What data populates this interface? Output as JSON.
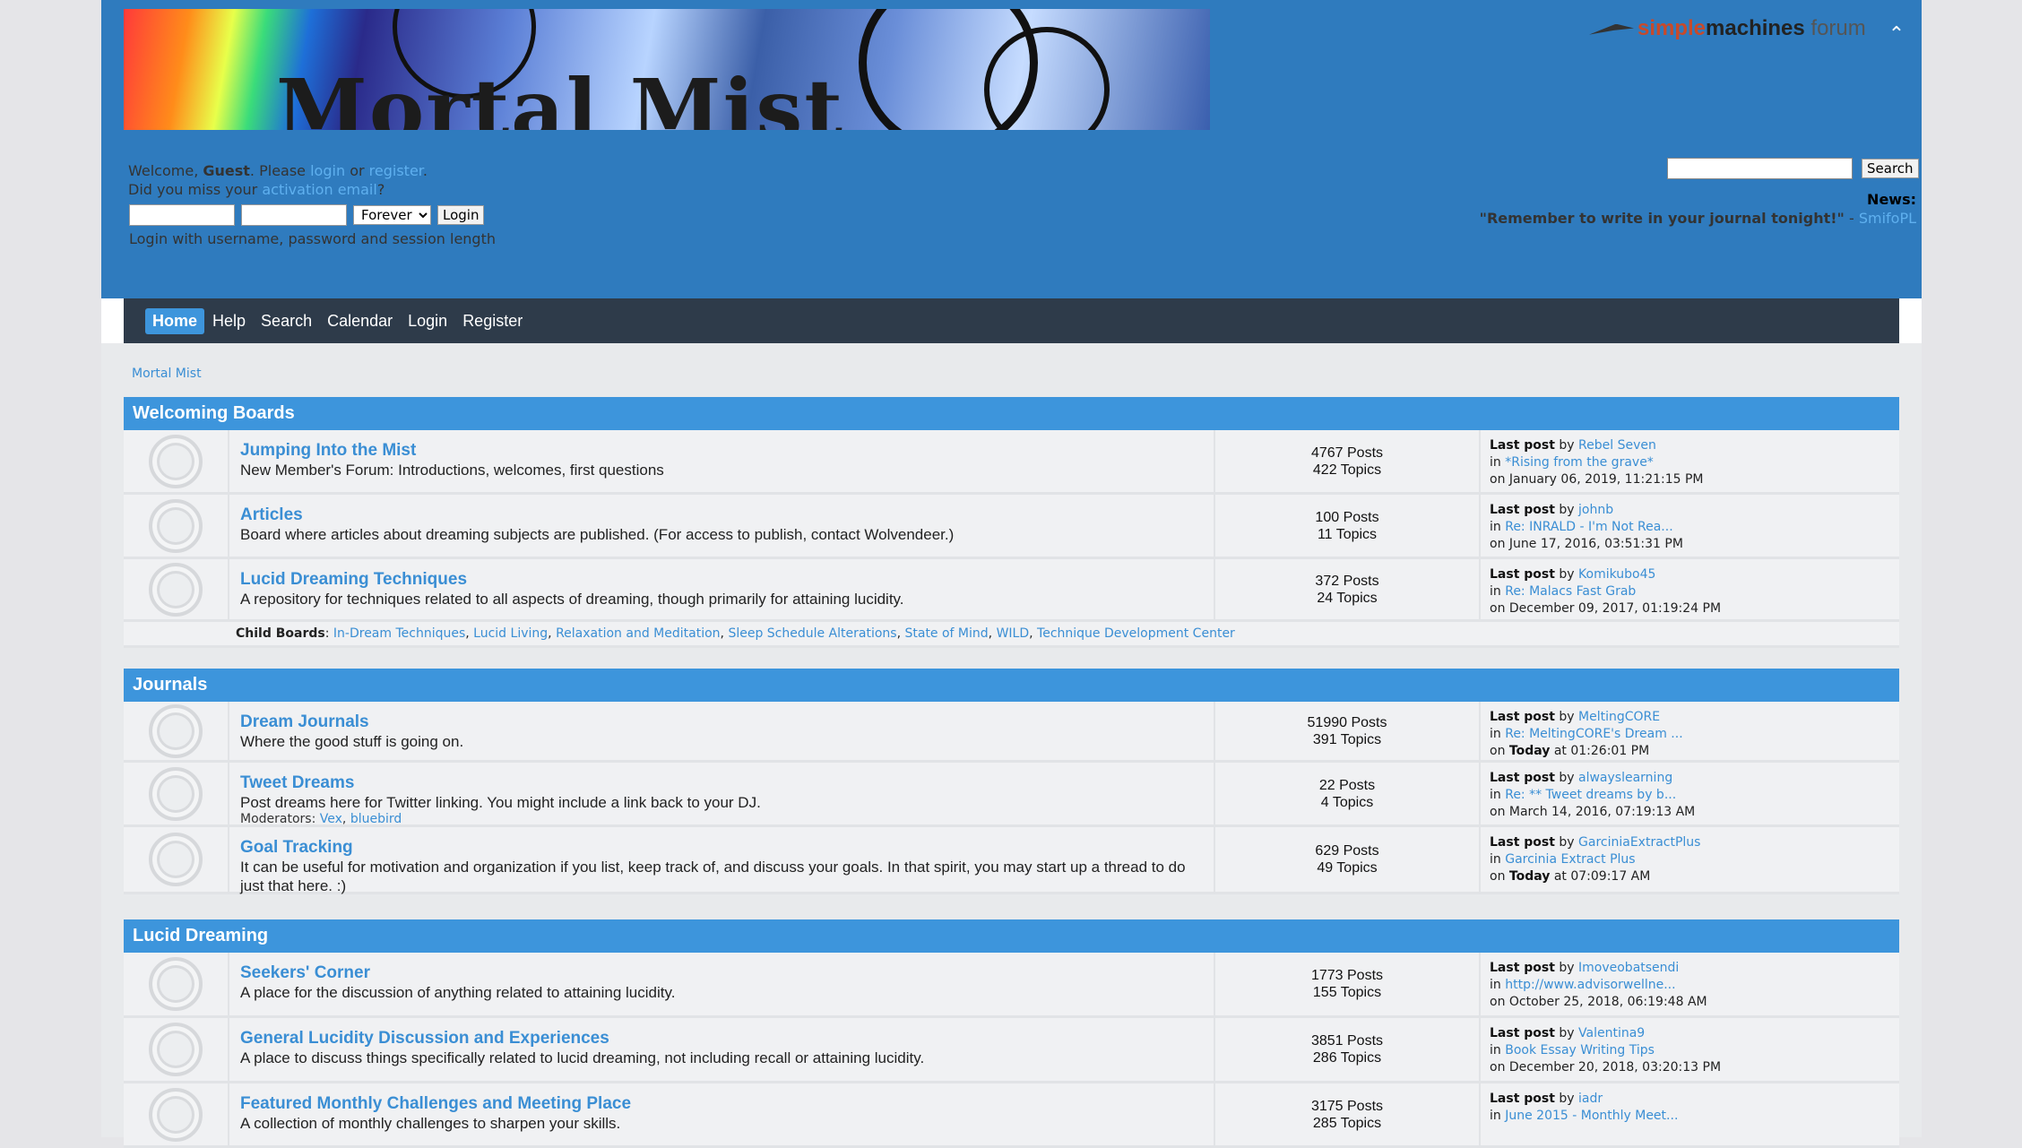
{
  "header": {
    "banner_title": "Mortal Mist",
    "smf_logo": {
      "simple": "simple",
      "machines": "machines",
      "forum": " forum"
    }
  },
  "user": {
    "welcome": "Welcome,",
    "guest": "Guest",
    "please": ". Please",
    "login_link": "login",
    "or": "or",
    "register_link": "register",
    "missed": "Did you miss your",
    "activation_link": "activation email",
    "qmark": "?",
    "login_option": "Forever",
    "login_button": "Login",
    "login_hint": "Login with username, password and session length"
  },
  "search": {
    "button": "Search"
  },
  "news": {
    "heading": "News:",
    "quote": "\"Remember to write in your journal tonight!\"",
    "author_sep": " - ",
    "author": "SmifoPL"
  },
  "menu": [
    "Home",
    "Help",
    "Search",
    "Calendar",
    "Login",
    "Register"
  ],
  "breadcrumb": "Mortal Mist",
  "categories": [
    {
      "title": "Welcoming Boards",
      "boards": [
        {
          "name": "Jumping Into the Mist",
          "desc": "New Member's Forum: Introductions, welcomes, first questions",
          "posts": "4767 Posts",
          "topics": "422 Topics",
          "last_by": "Rebel Seven",
          "last_in": "*Rising from the grave*",
          "last_on": "on January 06, 2019, 11:21:15 PM"
        },
        {
          "name": "Articles",
          "desc": "Board where articles about dreaming subjects are published. (For access to publish, contact Wolvendeer.)",
          "posts": "100 Posts",
          "topics": "11 Topics",
          "last_by": "johnb",
          "last_in": "Re: INRALD - I'm Not Rea...",
          "last_on": "on June 17, 2016, 03:51:31 PM"
        },
        {
          "name": "Lucid Dreaming Techniques",
          "desc": "A repository for techniques related to all aspects of dreaming, though primarily for attaining lucidity.",
          "posts": "372 Posts",
          "topics": "24 Topics",
          "last_by": "Komikubo45",
          "last_in": "Re: Malacs Fast Grab",
          "last_on": "on December 09, 2017, 01:19:24 PM"
        }
      ],
      "child_label": "Child Boards",
      "child_boards": [
        "In-Dream Techniques",
        "Lucid Living",
        "Relaxation and Meditation",
        "Sleep Schedule Alterations",
        "State of Mind",
        "WILD",
        "Technique Development Center"
      ]
    },
    {
      "title": "Journals",
      "boards": [
        {
          "name": "Dream Journals",
          "desc": "Where the good stuff is going on.",
          "posts": "51990 Posts",
          "topics": "391 Topics",
          "last_by": "MeltingCORE",
          "last_in": "Re: MeltingCORE's Dream ...",
          "last_on_prefix": "on",
          "last_on_bold": "Today",
          "last_on_rest": "at 01:26:01 PM"
        },
        {
          "name": "Tweet Dreams",
          "desc": "Post dreams here for Twitter linking. You might include a link back to your DJ.",
          "mods_label": "Moderators:",
          "mods": [
            "Vex",
            "bluebird"
          ],
          "posts": "22 Posts",
          "topics": "4 Topics",
          "last_by": "alwayslearning",
          "last_in": "Re: ** Tweet dreams by b...",
          "last_on": "on March 14, 2016, 07:19:13 AM"
        },
        {
          "name": "Goal Tracking",
          "desc": "It can be useful for motivation and organization if you list, keep track of, and discuss your goals. In that spirit, you may start up a thread to do just that here. :)",
          "posts": "629 Posts",
          "topics": "49 Topics",
          "last_by": "GarciniaExtractPlus",
          "last_in": "Garcinia Extract Plus",
          "last_on_prefix": "on",
          "last_on_bold": "Today",
          "last_on_rest": "at 07:09:17 AM"
        }
      ]
    },
    {
      "title": "Lucid Dreaming",
      "boards": [
        {
          "name": "Seekers' Corner",
          "desc": "A place for the discussion of anything related to attaining lucidity.",
          "posts": "1773 Posts",
          "topics": "155 Topics",
          "last_by": "Imoveobatsendi",
          "last_in": "http://www.advisorwellne...",
          "last_on": "on October 25, 2018, 06:19:48 AM"
        },
        {
          "name": "General Lucidity Discussion and Experiences",
          "desc": "A place to discuss things specifically related to lucid dreaming, not including recall or attaining lucidity.",
          "posts": "3851 Posts",
          "topics": "286 Topics",
          "last_by": "Valentina9",
          "last_in": "Book Essay Writing Tips",
          "last_on": "on December 20, 2018, 03:20:13 PM"
        },
        {
          "name": "Featured Monthly Challenges and Meeting Place",
          "desc": "A collection of monthly challenges to sharpen your skills.",
          "posts": "3175 Posts",
          "topics": "285 Topics",
          "last_by": "iadr",
          "last_in": "June 2015 - Monthly Meet...",
          "last_on": ""
        }
      ]
    }
  ],
  "labels": {
    "last_post": "Last post",
    "by": "by",
    "in": "in"
  },
  "colors": {
    "header_blue": "#2f7bbe",
    "accent": "#3d95dc",
    "menubar": "#2e3b4a",
    "link": "#3a8ed4"
  }
}
